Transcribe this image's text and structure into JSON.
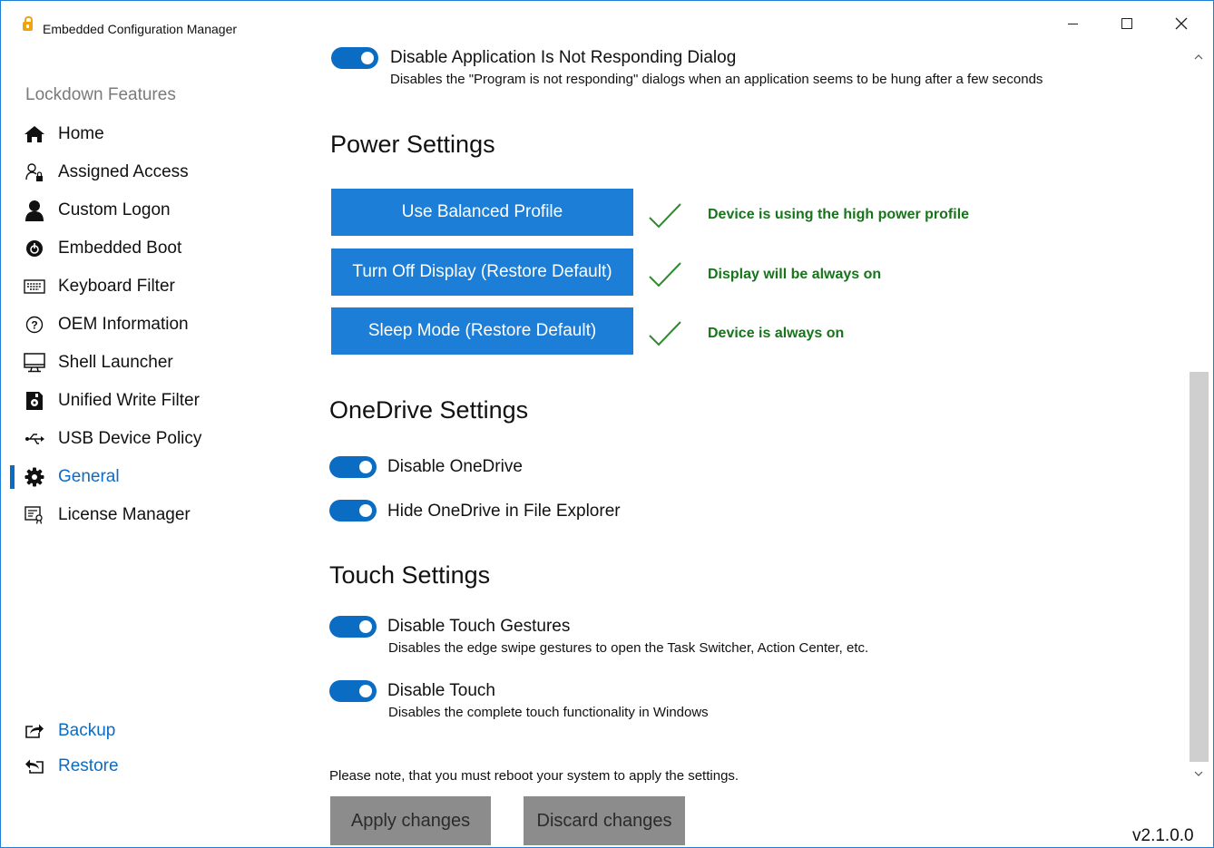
{
  "window": {
    "title": "Embedded Configuration Manager",
    "accent_color": "#0b6cc4",
    "version": "v2.1.0.0"
  },
  "sidebar": {
    "heading": "Lockdown Features",
    "items": [
      {
        "label": "Home",
        "icon": "home-icon",
        "active": false
      },
      {
        "label": "Assigned Access",
        "icon": "assigned-access-icon",
        "active": false
      },
      {
        "label": "Custom Logon",
        "icon": "person-icon",
        "active": false
      },
      {
        "label": "Embedded Boot",
        "icon": "boot-icon",
        "active": false
      },
      {
        "label": "Keyboard Filter",
        "icon": "keyboard-icon",
        "active": false
      },
      {
        "label": "OEM Information",
        "icon": "question-circle-icon",
        "active": false
      },
      {
        "label": "Shell Launcher",
        "icon": "monitor-icon",
        "active": false
      },
      {
        "label": "Unified Write Filter",
        "icon": "write-filter-icon",
        "active": false
      },
      {
        "label": "USB Device Policy",
        "icon": "usb-icon",
        "active": false
      },
      {
        "label": "General",
        "icon": "gear-icon",
        "active": true
      },
      {
        "label": "License Manager",
        "icon": "license-icon",
        "active": false
      }
    ],
    "footer_links": [
      {
        "label": "Backup",
        "icon": "backup-icon"
      },
      {
        "label": "Restore",
        "icon": "restore-icon"
      }
    ]
  },
  "main": {
    "top_toggle": {
      "label": "Disable Application Is Not Responding Dialog",
      "description": "Disables the \"Program is not responding\" dialogs when an application seems to be hung after a few seconds",
      "on": true
    },
    "power": {
      "title": "Power Settings",
      "rows": [
        {
          "button": "Use Balanced Profile",
          "status": "Device is using the high power profile"
        },
        {
          "button": "Turn Off Display (Restore Default)",
          "status": "Display will be always on"
        },
        {
          "button": "Sleep Mode (Restore Default)",
          "status": "Device is always on"
        }
      ],
      "status_color": "#18741b"
    },
    "onedrive": {
      "title": "OneDrive Settings",
      "toggles": [
        {
          "label": "Disable OneDrive",
          "on": true
        },
        {
          "label": "Hide OneDrive in File Explorer",
          "on": true
        }
      ]
    },
    "touch": {
      "title": "Touch Settings",
      "toggles": [
        {
          "label": "Disable Touch Gestures",
          "description": "Disables the edge swipe gestures to open the Task Switcher, Action Center, etc.",
          "on": true
        },
        {
          "label": "Disable Touch",
          "description": "Disables the complete touch functionality in Windows",
          "on": true
        }
      ]
    },
    "note": "Please note, that you must reboot your system to apply the settings.",
    "apply_label": "Apply changes",
    "discard_label": "Discard changes"
  }
}
